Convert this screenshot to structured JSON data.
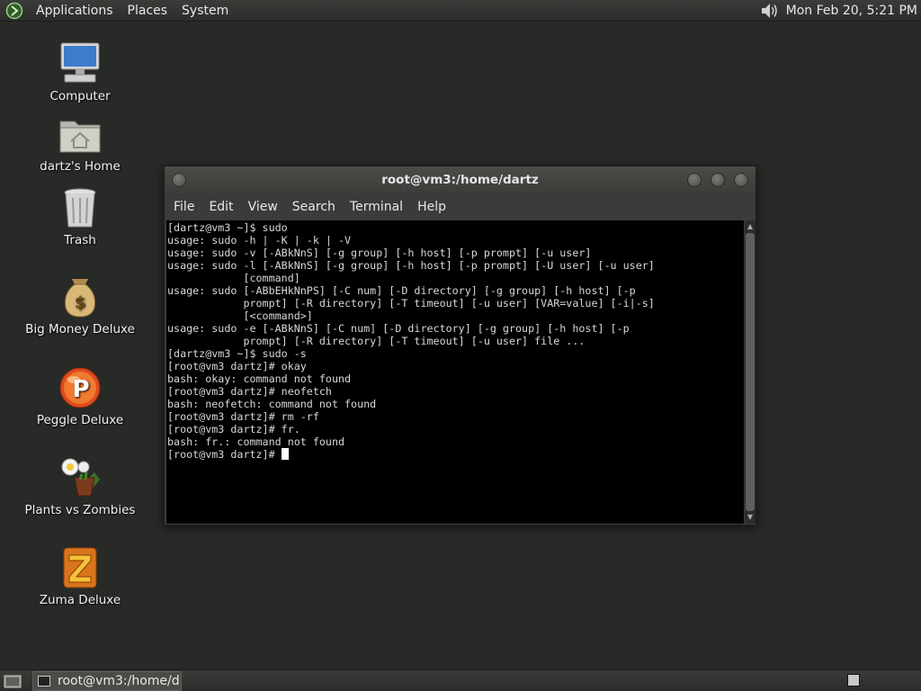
{
  "top_panel": {
    "menus": [
      "Applications",
      "Places",
      "System"
    ],
    "volume_icon": "speaker-icon",
    "clock": "Mon Feb 20,  5:21 PM"
  },
  "desktop_icons": [
    {
      "label": "Computer",
      "icon": "computer-icon"
    },
    {
      "label": "dartz's Home",
      "icon": "home-folder-icon"
    },
    {
      "label": "Trash",
      "icon": "trash-icon"
    },
    {
      "label": "Big Money Deluxe",
      "icon": "money-bag-icon"
    },
    {
      "label": "Peggle Deluxe",
      "icon": "peggle-icon"
    },
    {
      "label": "Plants vs Zombies",
      "icon": "plants-vs-zombies-icon"
    },
    {
      "label": "Zuma Deluxe",
      "icon": "zuma-icon"
    }
  ],
  "terminal": {
    "title": "root@vm3:/home/dartz",
    "menu": [
      "File",
      "Edit",
      "View",
      "Search",
      "Terminal",
      "Help"
    ],
    "lines": [
      "[dartz@vm3 ~]$ sudo",
      "usage: sudo -h | -K | -k | -V",
      "usage: sudo -v [-ABkNnS] [-g group] [-h host] [-p prompt] [-u user]",
      "usage: sudo -l [-ABkNnS] [-g group] [-h host] [-p prompt] [-U user] [-u user]",
      "            [command]",
      "usage: sudo [-ABbEHkNnPS] [-C num] [-D directory] [-g group] [-h host] [-p",
      "            prompt] [-R directory] [-T timeout] [-u user] [VAR=value] [-i|-s]",
      "            [<command>]",
      "usage: sudo -e [-ABkNnS] [-C num] [-D directory] [-g group] [-h host] [-p",
      "            prompt] [-R directory] [-T timeout] [-u user] file ...",
      "[dartz@vm3 ~]$ sudo -s",
      "[root@vm3 dartz]# okay",
      "bash: okay: command not found",
      "[root@vm3 dartz]# neofetch",
      "bash: neofetch: command not found",
      "[root@vm3 dartz]# rm -rf",
      "[root@vm3 dartz]# fr.",
      "bash: fr.: command not found"
    ],
    "prompt": "[root@vm3 dartz]# "
  },
  "bottom_panel": {
    "task_label": "root@vm3:/home/d..."
  },
  "colors": {
    "desktop_bg": "#282a27",
    "terminal_bg": "#000000",
    "terminal_fg": "#d8d8d8"
  }
}
